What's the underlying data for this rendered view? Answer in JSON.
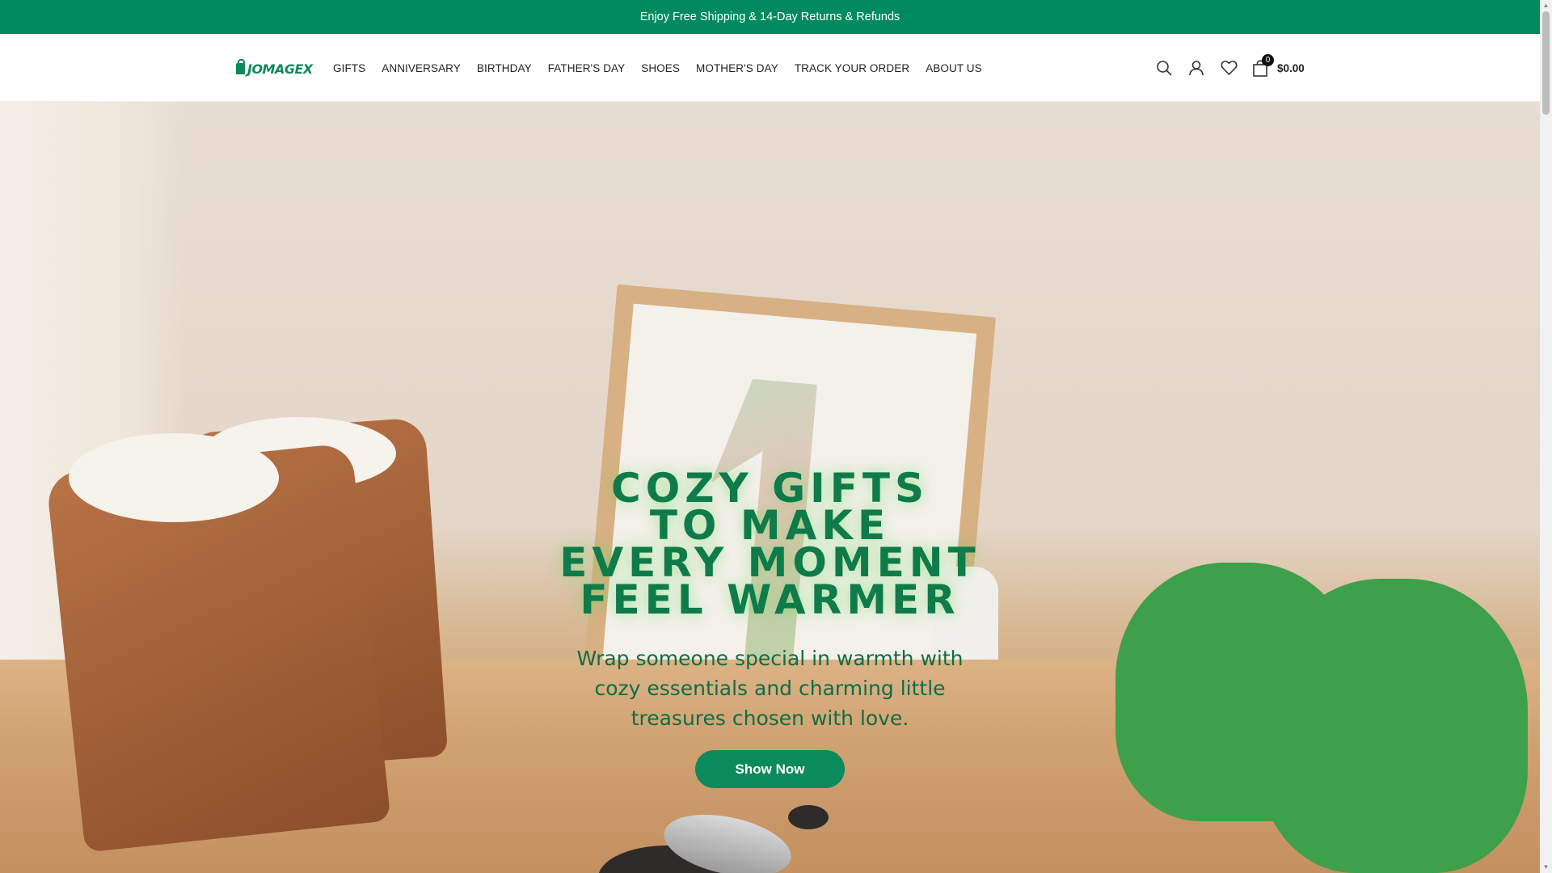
{
  "announcement": "Enjoy Free Shipping & 14-Day Returns & Refunds",
  "brand": {
    "logo_text": "JOMAGEX",
    "color": "#0c8a5a"
  },
  "nav": {
    "items": [
      {
        "label": "GIFTS"
      },
      {
        "label": "ANNIVERSARY"
      },
      {
        "label": "BIRTHDAY"
      },
      {
        "label": "FATHER'S DAY"
      },
      {
        "label": "SHOES"
      },
      {
        "label": "MOTHER'S DAY"
      },
      {
        "label": "TRACK YOUR ORDER"
      },
      {
        "label": "ABOUT US"
      }
    ]
  },
  "tools": {
    "search_icon": "search-icon",
    "account_icon": "user-icon",
    "wishlist_icon": "heart-icon",
    "cart_icon": "bag-icon",
    "cart_count": "0",
    "cart_total": "$0.00"
  },
  "hero": {
    "title_lines": [
      "Cozy Gifts",
      "to Make",
      "Every Moment",
      "Feel Warmer"
    ],
    "subtitle": "Wrap someone special in warmth with cozy essentials and charming little treasures chosen with love.",
    "button_label": "Show Now"
  },
  "colors": {
    "accent": "#008a5e",
    "button": "#0b8a5c",
    "title": "#0f7a4a"
  }
}
